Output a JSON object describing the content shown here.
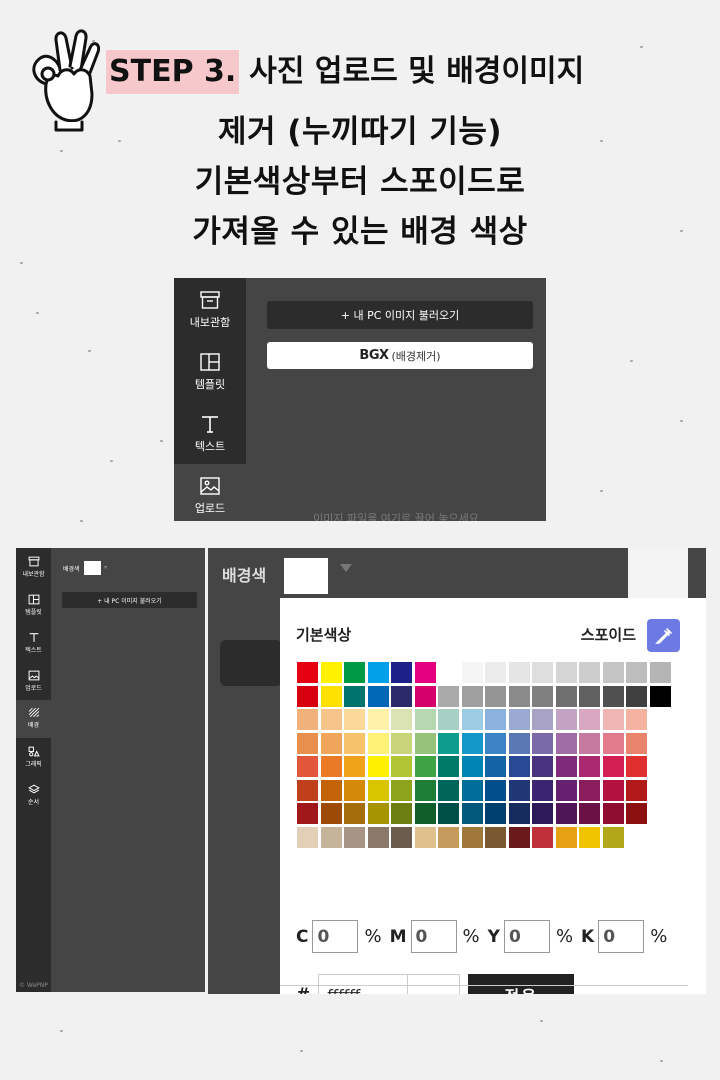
{
  "header": {
    "step_label": "STEP 3.",
    "step_title": "사진 업로드 및 배경이미지",
    "line2": "제거 (누끼따기 기능)",
    "line3": "기본색상부터 스포이드로",
    "line4": "가져올 수 있는 배경 색상"
  },
  "panel1": {
    "sidebar": [
      {
        "label": "내보관함",
        "icon": "archive-box-icon"
      },
      {
        "label": "템플릿",
        "icon": "template-layout-icon"
      },
      {
        "label": "텍스트",
        "icon": "text-t-icon"
      },
      {
        "label": "업로드",
        "icon": "image-upload-icon"
      }
    ],
    "upload_button": "+ 내 PC 이미지 불러오기",
    "bgx_logo": "BGX",
    "bgx_button_suffix": "(배경제거)",
    "drop_hint": "이미지 파일을 여기로 끌어 놓으세요"
  },
  "panel2": {
    "sidebar": [
      {
        "label": "내보관함",
        "icon": "archive-box-icon"
      },
      {
        "label": "템플릿",
        "icon": "template-layout-icon"
      },
      {
        "label": "텍스트",
        "icon": "text-t-icon"
      },
      {
        "label": "업로드",
        "icon": "image-upload-icon"
      },
      {
        "label": "배경",
        "icon": "background-hatch-icon"
      },
      {
        "label": "그래픽",
        "icon": "graphic-shapes-icon"
      },
      {
        "label": "순서",
        "icon": "layers-icon"
      }
    ],
    "bg_label": "배경색",
    "upload_button": "+ 내 PC 이미지 불러오기",
    "copyright": "© WePNP"
  },
  "panel3": {
    "bg_label": "배경색",
    "picker": {
      "basic_colors_title": "기본색상",
      "eyedropper_label": "스포이드",
      "palette": [
        [
          "#e60012",
          "#fff100",
          "#009944",
          "#00a0e9",
          "#1d2088",
          "#e4007f",
          null,
          "#f5f5f5",
          "#ececec",
          "#e5e5e5",
          "#dedede",
          "#d5d5d5",
          "#cdcdcd",
          "#c5c5c5",
          "#bdbdbd",
          "#b5b5b5"
        ],
        [
          "#d7000f",
          "#ffe100",
          "#00736d",
          "#0068b7",
          "#2d2a6b",
          "#d6006c",
          "#aaaaaa",
          "#9f9f9f",
          "#959595",
          "#8a8a8a",
          "#808080",
          "#707070",
          "#606060",
          "#505050",
          "#404040",
          "#000000"
        ],
        [
          "#f0b27a",
          "#f6c48a",
          "#fad89a",
          "#fff2a8",
          "#dce3b2",
          "#b7d7b0",
          "#a7d0c4",
          "#9ccce3",
          "#8ab2dc",
          "#9aaad0",
          "#a8a3c6",
          "#c2a3c4",
          "#d8a8c2",
          "#efb5b5",
          "#f3b3a0",
          null
        ],
        [
          "#e98f4e",
          "#efa55a",
          "#f6c36b",
          "#fff176",
          "#c7d47a",
          "#97c27a",
          "#0e9c8e",
          "#1498c9",
          "#3d84c6",
          "#5a78b4",
          "#7a6aa8",
          "#a06da6",
          "#c77aa0",
          "#e27c8c",
          "#e8846c",
          null
        ],
        [
          "#e2563c",
          "#ea7a26",
          "#f0a218",
          "#fff000",
          "#b0c434",
          "#3fa245",
          "#007a68",
          "#0083b5",
          "#1463a5",
          "#284a94",
          "#4a347f",
          "#7f2a7b",
          "#a9286e",
          "#d41f52",
          "#df2f2f",
          null
        ],
        [
          "#c1401c",
          "#c36307",
          "#d48a08",
          "#d9c400",
          "#8da31c",
          "#1e7e36",
          "#00665a",
          "#006e99",
          "#004f8a",
          "#1f3875",
          "#3b2570",
          "#652070",
          "#8a1d5b",
          "#b4123e",
          "#b21a1a",
          null
        ],
        [
          "#a1181a",
          "#9c4a05",
          "#a66d0b",
          "#a69400",
          "#6d7f12",
          "#105e29",
          "#004f46",
          "#00587b",
          "#00406f",
          "#162c5c",
          "#2c1a59",
          "#4e1656",
          "#6a1246",
          "#8e0d30",
          "#8c1010",
          null
        ],
        [
          "#e3cfb7",
          "#c5b39a",
          "#a69584",
          "#8b7a6a",
          "#6b5c4d",
          "#e0c08c",
          "#c59b5e",
          "#a0783c",
          "#7a5930",
          "#6a1a1a",
          "#c03038",
          "#e6a014",
          "#f0c400",
          "#b0a818",
          null,
          null
        ]
      ],
      "cmyk": [
        {
          "letter": "C",
          "value": "0",
          "unit": "%"
        },
        {
          "letter": "M",
          "value": "0",
          "unit": "%"
        },
        {
          "letter": "Y",
          "value": "0",
          "unit": "%"
        },
        {
          "letter": "K",
          "value": "0",
          "unit": "%"
        }
      ],
      "hex_symbol": "#",
      "hex_value": "ffffff",
      "apply_button": "적용"
    }
  }
}
